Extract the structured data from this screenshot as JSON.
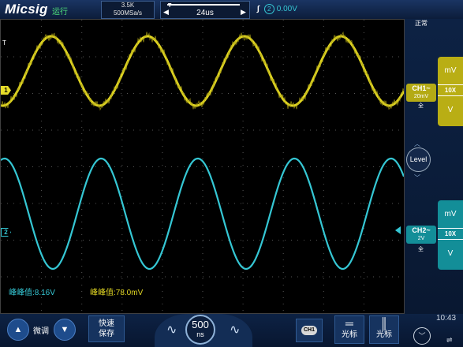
{
  "header": {
    "logo": "Micsig",
    "run_status": "运行",
    "memory_depth": "3.5K",
    "sample_rate": "500MSa/s",
    "trigger_position_marker": "T",
    "timebase": "24us",
    "trigger": {
      "edge_icon": "rising-edge-icon",
      "source": "2",
      "level": "0.00V"
    }
  },
  "screen": {
    "trigger_time_marker": "T",
    "ch1_marker": "1",
    "ch2_marker": "2",
    "measurements": {
      "ch2_peak_to_peak": "峰峰值:8.16V",
      "ch1_peak_to_peak": "峰峰值:78.0mV"
    }
  },
  "right_panel": {
    "acquisition_mode": "正常",
    "ch1": {
      "name": "CH1~",
      "scale": "20mV",
      "coupling": "全",
      "unit_top": "mV",
      "probe": "10X",
      "unit_bottom": "V"
    },
    "ch2": {
      "name": "CH2~",
      "scale": "2V",
      "coupling": "全",
      "unit_top": "mV",
      "probe": "10X",
      "unit_bottom": "V"
    },
    "level_knob": "Level"
  },
  "bottom": {
    "fine_label": "微调",
    "quick_save": [
      "快速",
      "保存"
    ],
    "timebase_knob_value": "500",
    "timebase_knob_unit": "ns",
    "channel_select": "CH1",
    "cursor_h_label": "光标",
    "cursor_v_label": "光标",
    "clock": "10:43"
  },
  "colors": {
    "ch1": "#e1d623",
    "ch2": "#35c7d4",
    "background": "#000000",
    "panel": "#0d2244"
  },
  "icons": {
    "fine_up": "triangle-up-icon",
    "fine_down": "triangle-down-icon",
    "wave_left": "sine-wave-icon",
    "wave_right": "sine-wave-icon",
    "cursor_h": "horizontal-cursor-icon",
    "cursor_v": "vertical-cursor-icon",
    "expand": "chevron-down-icon",
    "usb": "usb-icon"
  }
}
